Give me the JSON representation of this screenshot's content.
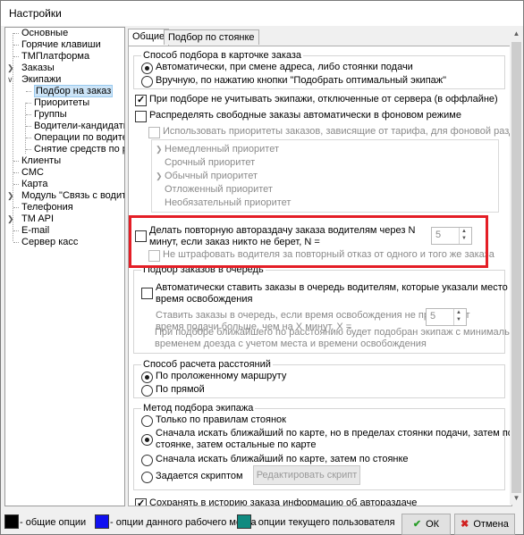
{
  "window": {
    "title": "Настройки"
  },
  "tree": {
    "items": [
      {
        "label": "Основные"
      },
      {
        "label": "Горячие клавиши"
      },
      {
        "label": "ТМПлатформа"
      },
      {
        "label": "Заказы"
      },
      {
        "label": "Экипажи"
      },
      {
        "label": "Подбор на заказ"
      },
      {
        "label": "Приоритеты"
      },
      {
        "label": "Группы"
      },
      {
        "label": "Водители-кандидаты"
      },
      {
        "label": "Операции по водителе"
      },
      {
        "label": "Снятие средств по рас"
      },
      {
        "label": "Клиенты"
      },
      {
        "label": "СМС"
      },
      {
        "label": "Карта"
      },
      {
        "label": "Модуль \"Связь с водителя"
      },
      {
        "label": "Телефония"
      },
      {
        "label": "TM API"
      },
      {
        "label": "E-mail"
      },
      {
        "label": "Сервер касс"
      }
    ]
  },
  "tabs": [
    {
      "label": "Общие"
    },
    {
      "label": "Подбор по стоянке"
    }
  ],
  "selection_method": {
    "title": "Способ подбора в карточке заказа",
    "opt_auto": "Автоматически, при смене адреса, либо стоянки подачи",
    "opt_manual": "Вручную, по нажатию кнопки \"Подобрать оптимальный экипаж\""
  },
  "options": {
    "ignore_offline": "При подборе не учитывать экипажи, отключенные от сервера (в оффлайне)",
    "background_distribution": "Распределять свободные заказы автоматически в фоновом режиме",
    "use_priorities": "Использовать приоритеты заказов, зависящие от тарифа, для фоновой раздачи"
  },
  "priorities": [
    {
      "label": "Немедленный приоритет"
    },
    {
      "label": "Срочный приоритет"
    },
    {
      "label": "Обычный приоритет"
    },
    {
      "label": "Отложенный приоритет"
    },
    {
      "label": "Необязательный приоритет"
    }
  ],
  "repeat": {
    "label_line1": "Делать повторную автораздачу заказа водителям через N",
    "label_line2": "минут, если заказ никто не берет, N =",
    "value": "5",
    "no_penalty": "Не штрафовать водителя за повторный отказ от одного и того же заказа"
  },
  "queue": {
    "title": "Подбор заказов в очередь",
    "auto_line1": "Автоматически ставить заказы в очередь водителям, которые указали место и",
    "auto_line2": "время освобождения",
    "text_line1": "Ставить заказы в очередь, если время освобождения не превышает",
    "text_line2": "время подачи больше, чем на X минут, X =",
    "value": "5",
    "note_line1": "При подборе ближайшего по расстоянию будет подобран экипаж с минимальным",
    "note_line2": "временем доезда с учетом места и времени освобождения"
  },
  "distance": {
    "title": "Способ расчета расстояний",
    "opt_route": "По проложенному маршруту",
    "opt_straight": "По прямой"
  },
  "crew_method": {
    "title": "Метод подбора экипажа",
    "opt_parking": "Только по правилам стоянок",
    "opt_map_parking_line1": "Сначала искать ближайший по карте, но в пределах стоянки подачи, затем по",
    "opt_map_parking_line2": "стоянке, затем остальные по карте",
    "opt_map_then_parking": "Сначала искать ближайший по карте, затем по стоянке",
    "opt_script": "Задается скриптом",
    "edit_script": "Редактировать скрипт"
  },
  "save_history": "Сохранять в историю заказа информацию об автораздаче",
  "legend": [
    {
      "label": "- общие опции",
      "color": "#000000"
    },
    {
      "label": "- опции данного рабочего места",
      "color": "#1010f0"
    },
    {
      "label": "- опции текущего пользователя",
      "color": "#108a80"
    }
  ],
  "buttons": {
    "ok": "ОК",
    "cancel": "Отмена"
  }
}
